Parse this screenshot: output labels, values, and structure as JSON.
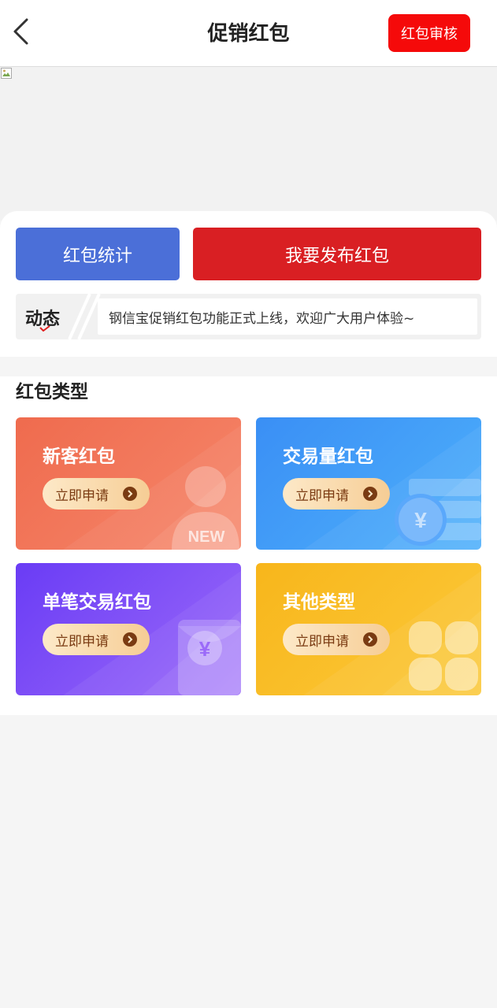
{
  "header": {
    "title": "促销红包",
    "audit_button": "红包审核"
  },
  "actions": {
    "stats_button": "红包统计",
    "publish_button": "我要发布红包"
  },
  "news": {
    "label": "动态",
    "text": "钢信宝促销红包功能正式上线，欢迎广大用户体验~"
  },
  "types": {
    "title": "红包类型",
    "cards": [
      {
        "title": "新客红包",
        "button": "立即申请",
        "deco_text": "NEW",
        "icon": "new-user-icon"
      },
      {
        "title": "交易量红包",
        "button": "立即申请",
        "deco_text": "¥",
        "icon": "coin-stack-icon"
      },
      {
        "title": "单笔交易红包",
        "button": "立即申请",
        "deco_text": "¥",
        "icon": "red-envelope-icon"
      },
      {
        "title": "其他类型",
        "button": "立即申请",
        "icon": "clover-icon"
      }
    ]
  },
  "colors": {
    "audit": "#f50a0a",
    "stats": "#4b6fd8",
    "publish": "#d91f23",
    "card_new": "#ef6b4e",
    "card_volume": "#3a8ff5",
    "card_single": "#6a3cf5",
    "card_other": "#f8b61b"
  }
}
